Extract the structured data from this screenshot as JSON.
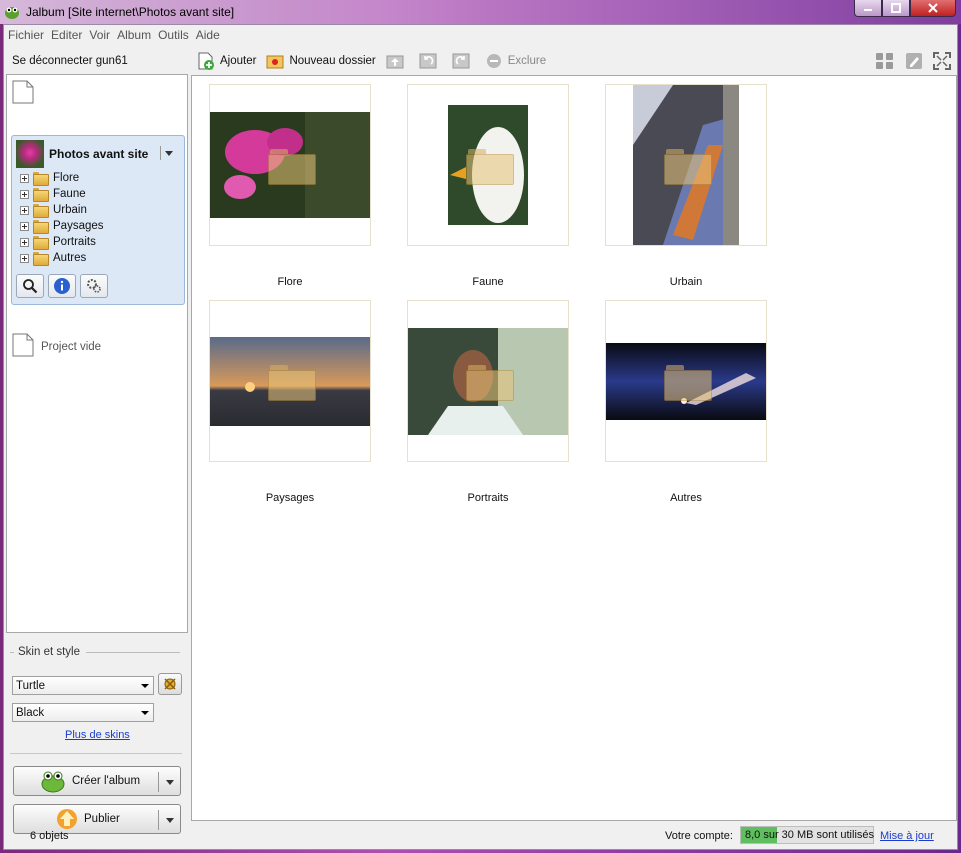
{
  "window": {
    "title": "Jalbum [Site internet\\Photos avant site]"
  },
  "menu": [
    "Fichier",
    "Editer",
    "Voir",
    "Album",
    "Outils",
    "Aide"
  ],
  "sidebar": {
    "login_label": "Se déconnecter gun61",
    "project": {
      "title": "Photos avant site",
      "folders": [
        "Flore",
        "Faune",
        "Urbain",
        "Paysages",
        "Portraits",
        "Autres"
      ]
    },
    "empty_project": "Project vide"
  },
  "skin": {
    "section_label": "Skin et style",
    "skin_value": "Turtle",
    "style_value": "Black",
    "more_skins": "Plus de skins"
  },
  "actions": {
    "create_album": "Créer l'album",
    "publish": "Publier"
  },
  "toolbar": {
    "add": "Ajouter",
    "new_folder": "Nouveau dossier",
    "exclude": "Exclure"
  },
  "gallery": {
    "items": [
      {
        "label": "Flore"
      },
      {
        "label": "Faune"
      },
      {
        "label": "Urbain"
      },
      {
        "label": "Paysages"
      },
      {
        "label": "Portraits"
      },
      {
        "label": "Autres"
      }
    ]
  },
  "status": {
    "count": "6 objets",
    "account_label": "Votre compte:",
    "quota_text": "8,0 sur 30 MB sont utilisés",
    "quota_used_fraction": 0.27,
    "update_link": "Mise à jour"
  },
  "colors": {
    "quota_fill": "#5fbf5f",
    "link": "#1a3ccc",
    "project_bg": "#dce8f6"
  }
}
